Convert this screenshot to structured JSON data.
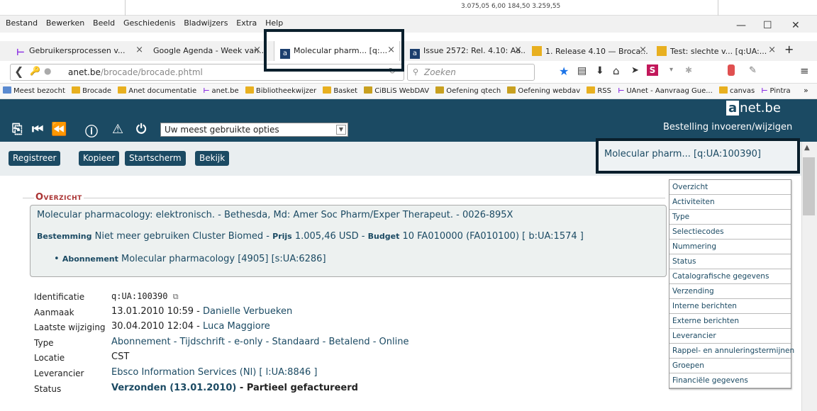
{
  "top_strip": {
    "numbers": "3.075,05    6,00  184,50   3.259,55"
  },
  "menu": [
    "Bestand",
    "Bewerken",
    "Beeld",
    "Geschiedenis",
    "Bladwijzers",
    "Extra",
    "Help"
  ],
  "window_controls": {
    "minimize": "—",
    "maximize": "☐",
    "close": "✕"
  },
  "tabs": [
    {
      "label": "Gebruikersprocessen v...",
      "icon": "uanet-icon"
    },
    {
      "label": "Google Agenda - Week van...",
      "icon": "none"
    },
    {
      "label": "Molecular pharm... [q:...",
      "icon": "anet-icon",
      "active": true
    },
    {
      "label": "Issue 2572: Rel. 4.10: Aa...",
      "icon": "anet-icon"
    },
    {
      "label": "1. Release 4.10 — Broca...",
      "icon": "bucket-icon"
    },
    {
      "label": "Test: slechte v... [q:UA:...",
      "icon": "bucket-icon"
    }
  ],
  "new_tab": "+",
  "address": {
    "host": "anet.be",
    "path": "/brocade/brocade.phtml"
  },
  "search": {
    "placeholder": "Zoeken"
  },
  "bookmarks": [
    "Meest bezocht",
    "Brocade",
    "Anet documentatie",
    "anet.be",
    "Bibliotheekwijzer",
    "Basket",
    "CiBLiS WebDAV",
    "Oefening qtech",
    "Oefening webdav",
    "RSS",
    "UAnet - Aanvraag Gue...",
    "canvas",
    "Pintra"
  ],
  "bookmarks_more": "»",
  "app": {
    "logo_a": "a",
    "logo_text": "net.be",
    "subtitle": "Bestelling invoeren/wijzigen",
    "options_select": "Uw meest gebruikte opties"
  },
  "buttons": [
    "Registreer",
    "Kopieer",
    "Startscherm",
    "Bekijk"
  ],
  "current_record": "Molecular pharm... [q:UA:100390]",
  "overview": {
    "title": "Overzicht",
    "line1": "Molecular pharmacology: elektronisch. - Bethesda, Md: Amer Soc Pharm/Exper Therapeut. - 0026-895X",
    "bestemming_label": "Bestemming",
    "bestemming_value": "Niet meer gebruiken Cluster Biomed",
    "prijs_label": "Prijs",
    "prijs_value": "1.005,46 USD",
    "budget_label": "Budget",
    "budget_value": "10 FA010000 (FA010100) [ b:UA:1574 ]",
    "abonnement_label": "Abonnement",
    "abonnement_value": "Molecular pharmacology [4905] [s:UA:6286]"
  },
  "fields": [
    {
      "label": "Identificatie",
      "value": "q:UA:100390",
      "extra": ""
    },
    {
      "label": "Aanmaak",
      "value": "13.01.2010 10:59",
      "extra": "Danielle Verbueken"
    },
    {
      "label": "Laatste wijziging",
      "value": "30.04.2010 12:04",
      "extra": "Luca Maggiore"
    },
    {
      "label": "Type",
      "value": "Abonnement - Tijdschrift - e-only - Standaard - Betalend - Online",
      "extra": ""
    },
    {
      "label": "Locatie",
      "value": "CST",
      "extra": ""
    },
    {
      "label": "Leverancier",
      "value": "Ebsco Information Services (Nl)  [ l:UA:8846 ]",
      "extra": ""
    },
    {
      "label": "Status",
      "value": "Verzonden (13.01.2010)",
      "extra": "Partieel gefactureerd"
    }
  ],
  "right_menu": [
    "Overzicht",
    "Activiteiten",
    "Type",
    "Selectiecodes",
    "Nummering",
    "Status",
    "Catalografische gegevens",
    "Verzending",
    "Interne berichten",
    "Externe berichten",
    "Leverancier",
    "Rappel- en annuleringstermijnen",
    "Groepen",
    "Financiële gegevens"
  ]
}
